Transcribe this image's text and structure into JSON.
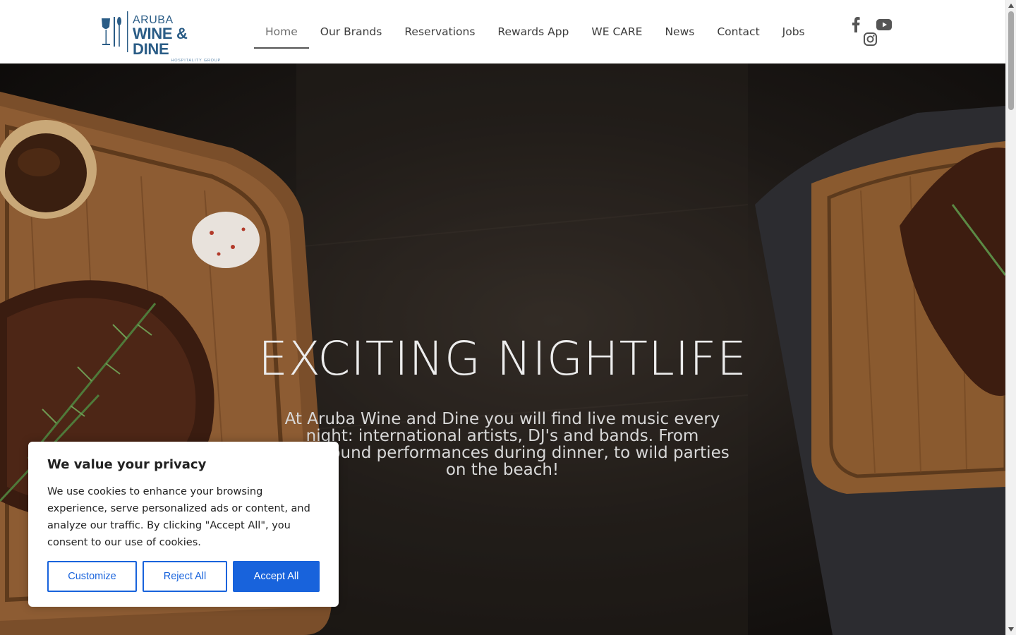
{
  "brand": {
    "line1": "ARUBA",
    "line2": "WINE & DINE",
    "line3": "HOSPITALITY GROUP"
  },
  "nav": {
    "items": [
      {
        "label": "Home",
        "active": true
      },
      {
        "label": "Our Brands"
      },
      {
        "label": "Reservations"
      },
      {
        "label": "Rewards App"
      },
      {
        "label": "WE CARE"
      },
      {
        "label": "News"
      },
      {
        "label": "Contact"
      },
      {
        "label": "Jobs"
      }
    ]
  },
  "social": [
    "facebook-icon",
    "youtube-icon",
    "instagram-icon"
  ],
  "hero": {
    "title": "EXCITING NIGHTLIFE",
    "text": "At Aruba Wine and Dine you will find live music every night: international artists, DJ's and bands. From background performances during dinner, to wild parties on the beach!"
  },
  "cookie": {
    "title": "We value your privacy",
    "body": "We use cookies to enhance your browsing experience, serve personalized ads or content, and analyze our traffic. By clicking \"Accept All\", you consent to our use of cookies.",
    "customize": "Customize",
    "reject": "Reject All",
    "accept": "Accept All"
  },
  "colors": {
    "brand_blue": "#2a5c86",
    "cookie_accent": "#1863dc"
  }
}
